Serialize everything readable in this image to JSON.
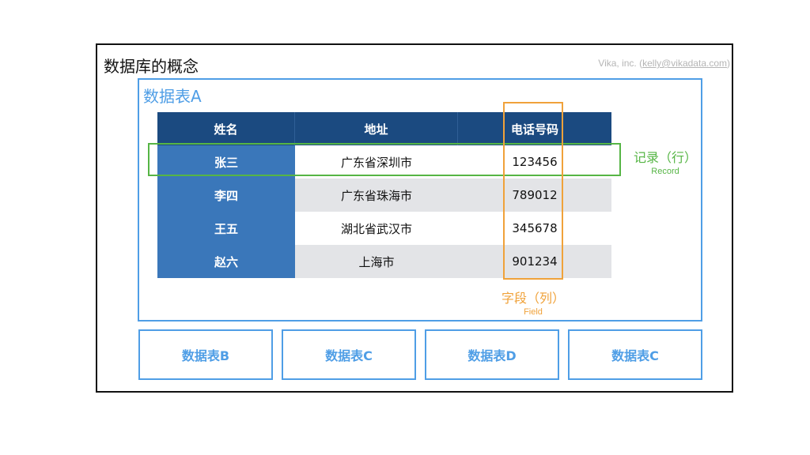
{
  "title": "数据库的概念",
  "credit": {
    "prefix": "Vika, inc. (",
    "email": "kelly@vikadata.com",
    "suffix": ")"
  },
  "table_a": {
    "title": "数据表A",
    "headers": [
      "姓名",
      "地址",
      "电话号码"
    ],
    "rows": [
      {
        "name": "张三",
        "address": "广东省深圳市",
        "phone": "123456"
      },
      {
        "name": "李四",
        "address": "广东省珠海市",
        "phone": "789012"
      },
      {
        "name": "王五",
        "address": "湖北省武汉市",
        "phone": "345678"
      },
      {
        "name": "赵六",
        "address": "上海市",
        "phone": "901234"
      }
    ]
  },
  "record_label": {
    "zh": "记录（行）",
    "en": "Record"
  },
  "field_label": {
    "zh": "字段（列）",
    "en": "Field"
  },
  "other_tables": [
    "数据表B",
    "数据表C",
    "数据表D",
    "数据表C"
  ],
  "colors": {
    "table_border": "#4f9ee6",
    "header_bg": "#1b4a80",
    "name_col_bg": "#3a77ba",
    "record_highlight": "#56b545",
    "field_highlight": "#f0a23a"
  }
}
